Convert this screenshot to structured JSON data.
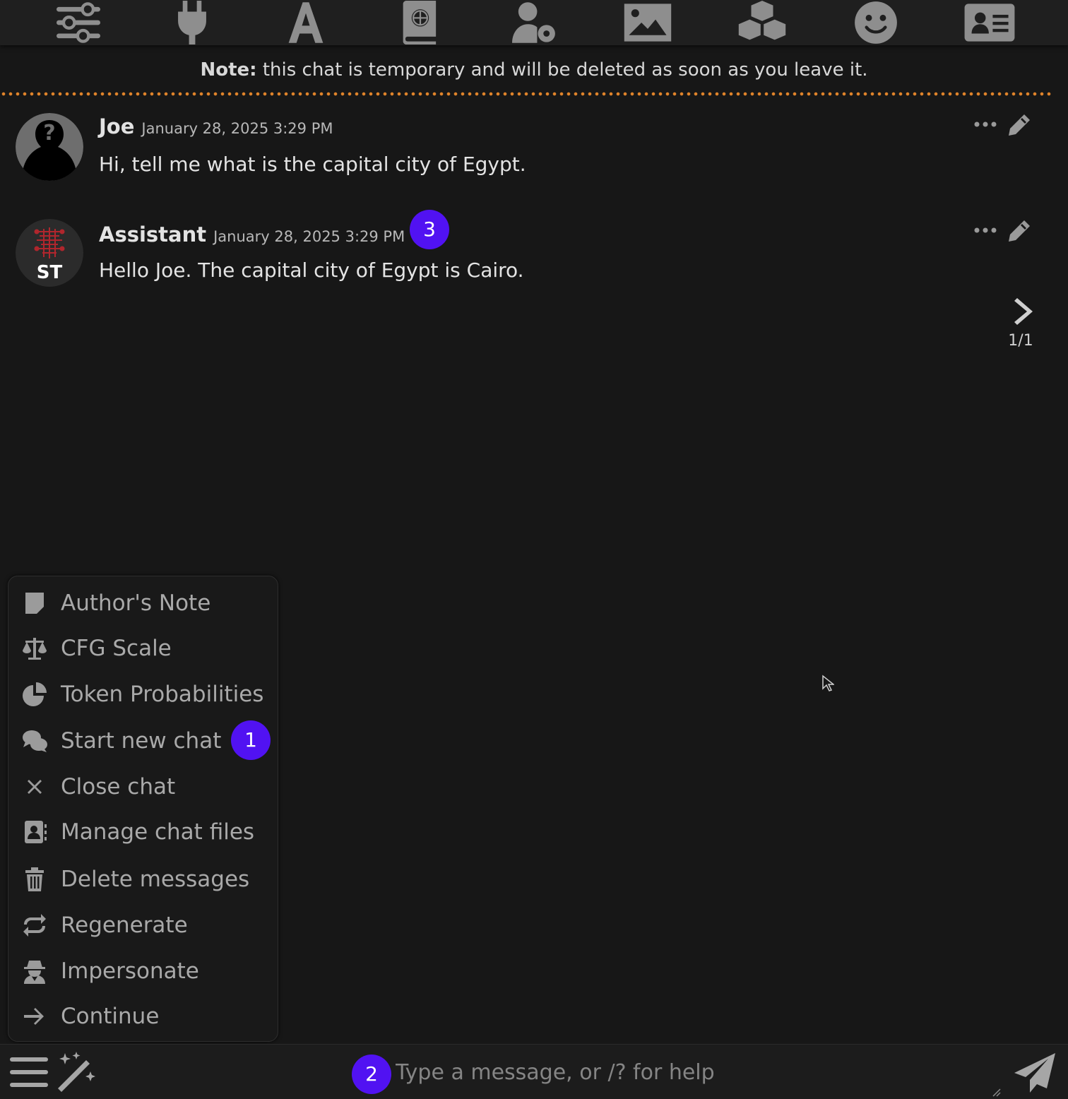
{
  "top_nav": {
    "icons": [
      "sliders-icon",
      "plug-icon",
      "font-icon",
      "book-atlas-icon",
      "user-gear-icon",
      "image-icon",
      "cubes-icon",
      "smile-icon",
      "id-card-icon"
    ]
  },
  "note": {
    "prefix": "Note:",
    "text": "this chat is temporary and will be deleted as soon as you leave it.",
    "divider_color": "#e0842a"
  },
  "messages": [
    {
      "name": "Joe",
      "timestamp": "January 28, 2025 3:29 PM",
      "text": "Hi, tell me what is the capital city of Egypt."
    },
    {
      "name": "Assistant",
      "timestamp": "January 28, 2025 3:29 PM",
      "text": "Hello Joe. The capital city of Egypt is Cairo.",
      "help_mark": "?",
      "avatar_text": "ST"
    }
  ],
  "swipe": {
    "counter": "1/1"
  },
  "badges": {
    "b1": "1",
    "b2": "2",
    "b3": "3",
    "color": "#5112f2"
  },
  "options_menu": {
    "items": [
      {
        "label": "Author's Note",
        "icon": "sticky-note-icon"
      },
      {
        "label": "CFG Scale",
        "icon": "scale-balanced-icon"
      },
      {
        "label": "Token Probabilities",
        "icon": "chart-pie-icon"
      },
      {
        "label": "Start new chat",
        "icon": "comments-icon"
      },
      {
        "label": "Close chat",
        "icon": "xmark-icon"
      },
      {
        "label": "Manage chat files",
        "icon": "address-book-icon"
      },
      {
        "label": "Delete messages",
        "icon": "trash-icon"
      },
      {
        "label": "Regenerate",
        "icon": "repeat-icon"
      },
      {
        "label": "Impersonate",
        "icon": "user-secret-icon"
      },
      {
        "label": "Continue",
        "icon": "arrow-right-icon"
      }
    ]
  },
  "input": {
    "placeholder": "Type a message, or /? for help",
    "value": ""
  }
}
